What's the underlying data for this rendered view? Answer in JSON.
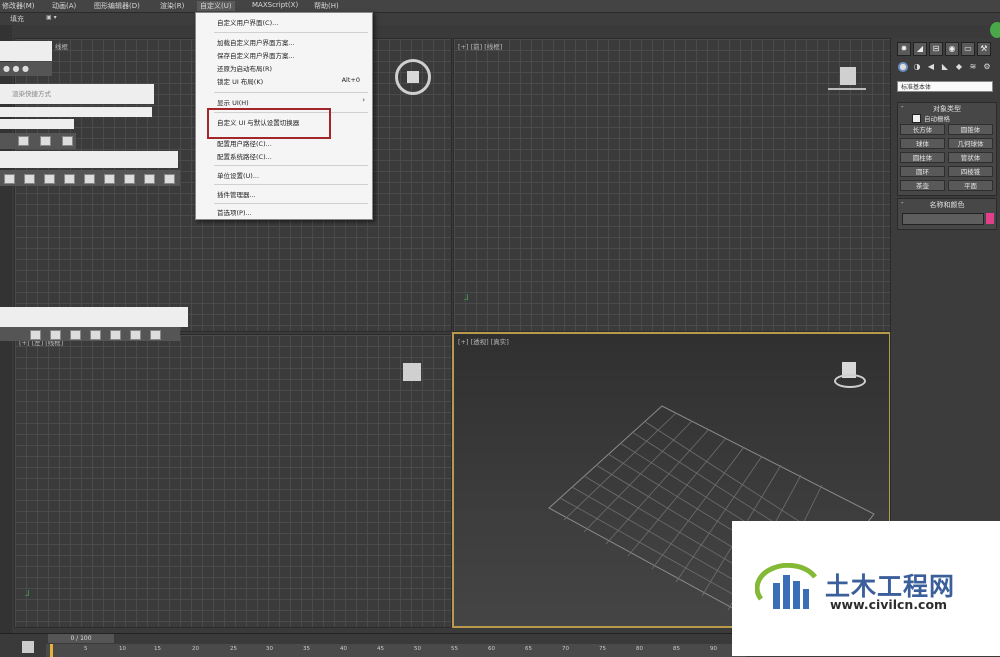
{
  "menubar": {
    "items": [
      "修改器(M)",
      "动画(A)",
      "图形编辑器(D)",
      "渲染(R)",
      "自定义(U)",
      "MAXScript(X)",
      "帮助(H)"
    ]
  },
  "subbar": {
    "label": "填充"
  },
  "dropdown": {
    "items": [
      {
        "label": "自定义用户界面(C)..."
      },
      {
        "label": "加载自定义用户界面方案..."
      },
      {
        "label": "保存自定义用户界面方案..."
      },
      {
        "label": "还原为启动布局(R)"
      },
      {
        "label": "锁定 UI 布局(K)",
        "shortcut": "Alt+0"
      },
      {
        "label": "显示 UI(H)",
        "arrow": "›"
      },
      {
        "label": "自定义 UI 与默认设置切换器"
      },
      {
        "label": "配置用户路径(C)..."
      },
      {
        "label": "配置系统路径(C)..."
      },
      {
        "label": "单位设置(U)..."
      },
      {
        "label": "插件管理器..."
      },
      {
        "label": "首选项(P)..."
      }
    ],
    "highlighted_item": "自定义 UI 与默认设置切换器",
    "highlight_color": "#a2262a"
  },
  "viewports": {
    "top_left_label": "线框",
    "top_right_label": "[+] [前] [线框]",
    "bottom_left_label": "[+] [左] [线框]",
    "bottom_right_label": "[+] [透视] [真实]"
  },
  "left_panel": {
    "render_dropdown": "渲染快捷方式"
  },
  "command_panel": {
    "tab_icons": [
      "sun-icon",
      "curve-icon",
      "hierarchy-icon",
      "motion-icon",
      "display-icon",
      "utility-icon"
    ],
    "sub_icons": [
      "geometry-icon",
      "shape-icon",
      "light-icon",
      "camera-icon",
      "helper-icon",
      "spacewarp-icon",
      "system-icon"
    ],
    "category": "标准基本体",
    "rollout_object_type": {
      "title": "对象类型",
      "minus": "-",
      "autogrid_label": "自动栅格",
      "buttons": [
        "长方体",
        "圆锥体",
        "球体",
        "几何球体",
        "圆柱体",
        "管状体",
        "圆环",
        "四棱锥",
        "茶壶",
        "平面"
      ]
    },
    "rollout_name_color": {
      "title": "名称和颜色",
      "minus": "-",
      "swatch_color": "#e0408a"
    }
  },
  "timeline": {
    "frame_counter": "0 / 100",
    "ticks": [
      "5",
      "10",
      "15",
      "20",
      "25",
      "30",
      "35",
      "40",
      "45",
      "50",
      "55",
      "60",
      "65",
      "70",
      "75",
      "80",
      "85",
      "90"
    ]
  },
  "watermark": {
    "title": "土木工程网",
    "url": "www.civilcn.com"
  }
}
